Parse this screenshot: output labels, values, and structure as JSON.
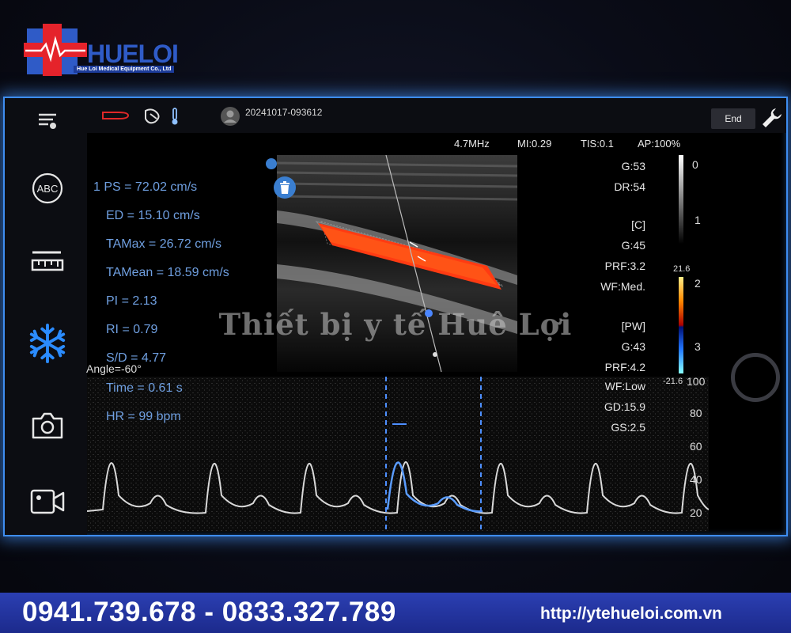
{
  "brand": {
    "name_part1": "HUE",
    "name_part2": "LOI",
    "subtitle": "Hue Loi Medical Equipment Co., Ltd"
  },
  "topbar": {
    "timestamp": "20241017-093612",
    "end_label": "End"
  },
  "sidebar": {
    "items": [
      {
        "name": "abc-annotation",
        "label": "ABC"
      },
      {
        "name": "measure"
      },
      {
        "name": "freeze"
      },
      {
        "name": "camera"
      },
      {
        "name": "video"
      }
    ]
  },
  "imaging_params": {
    "frequency": "4.7MHz",
    "mi": "MI:0.29",
    "tis": "TIS:0.1",
    "ap": "AP:100%"
  },
  "settings_2d": {
    "gain": "G:53",
    "dr": "DR:54"
  },
  "settings_color": {
    "title": "[C]",
    "gain": "G:45",
    "prf": "PRF:3.2",
    "wf": "WF:Med."
  },
  "settings_pw": {
    "title": "[PW]",
    "gain": "G:43",
    "prf": "PRF:4.2",
    "wf": "WF:Low",
    "gd": "GD:15.9",
    "gs": "GS:2.5"
  },
  "measurements": [
    "1 PS = 72.02 cm/s",
    "ED = 15.10 cm/s",
    "TAMax = 26.72 cm/s",
    "TAMean = 18.59 cm/s",
    "PI = 2.13",
    "RI = 0.79",
    "S/D = 4.77",
    "Time = 0.61 s",
    "HR = 99 bpm"
  ],
  "angle_label": "Angle=-60°",
  "grayscale_scale": [
    "0",
    "1",
    "2",
    "3"
  ],
  "color_scale": {
    "top": "21.6",
    "bottom": "-21.6"
  },
  "velocity_scale": [
    "100",
    "80",
    "60",
    "40",
    "20"
  ],
  "watermark": "Thiết bị y tế Huê Lợi",
  "footer": {
    "phones": "0941.739.678 - 0833.327.789",
    "url": "http://ytehueloi.com.vn"
  },
  "colors": {
    "accent": "#3e8df0",
    "measurement_text": "#6f9fe0",
    "footer_bg": "#2b3fb2",
    "logo_red": "#e5232b",
    "logo_blue": "#2f5bc7"
  }
}
